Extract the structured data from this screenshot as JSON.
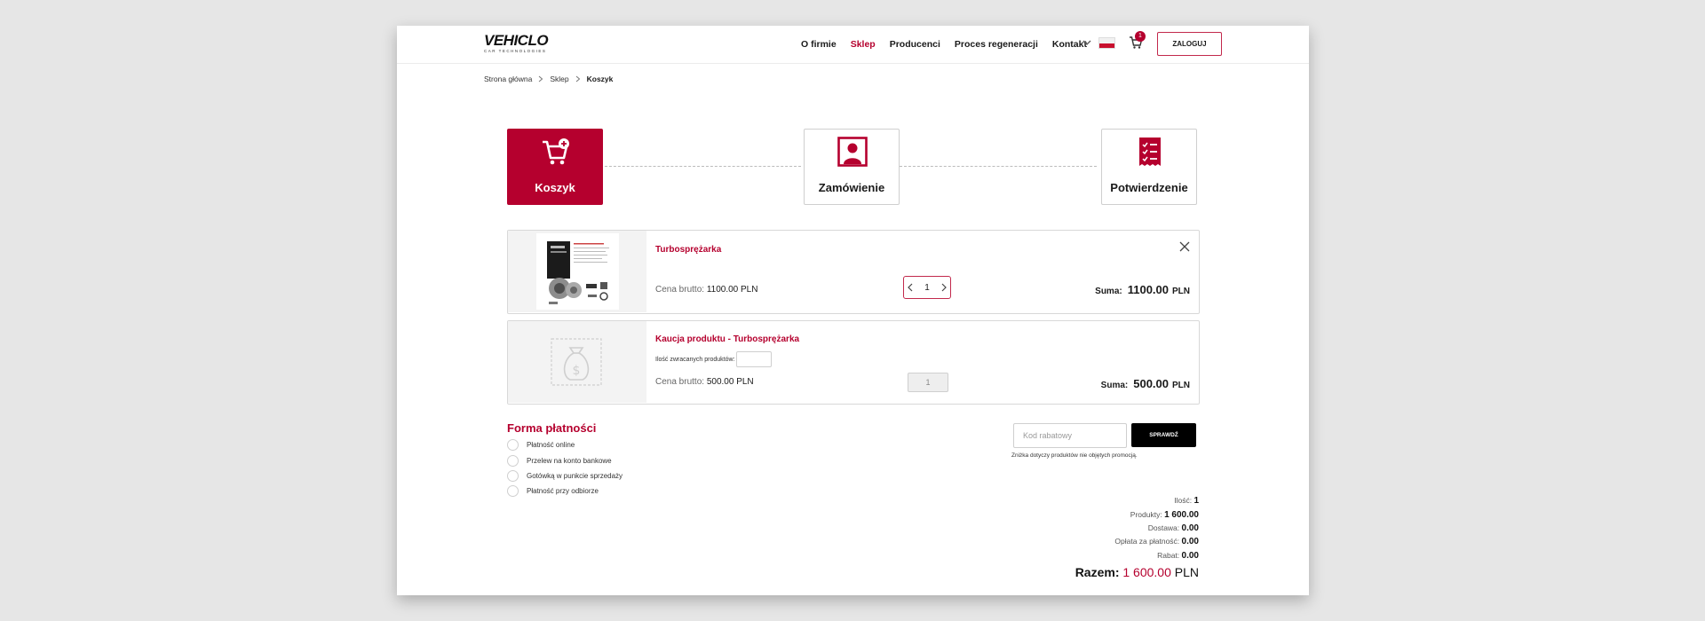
{
  "header": {
    "logo_main": "VEHICLO",
    "logo_sub": "CAR TECHNOLOGIES",
    "nav": [
      {
        "label": "O firmie",
        "active": false
      },
      {
        "label": "Sklep",
        "active": true
      },
      {
        "label": "Producenci",
        "active": false
      },
      {
        "label": "Proces regeneracji",
        "active": false
      },
      {
        "label": "Kontakt",
        "active": false
      }
    ],
    "cart_count": "1",
    "login_label": "ZALOGUJ",
    "icons": {
      "language": "chevron-down-icon",
      "flag": "poland-flag-icon",
      "cart": "cart-icon"
    }
  },
  "breadcrumb": {
    "items": [
      "Strona główna",
      "Sklep",
      "Koszyk"
    ]
  },
  "steps": [
    {
      "label": "Koszyk",
      "icon": "cart-plus-icon",
      "active": true
    },
    {
      "label": "Zamówienie",
      "icon": "user-icon",
      "active": false
    },
    {
      "label": "Potwierdzenie",
      "icon": "checklist-icon",
      "active": false
    }
  ],
  "items": [
    {
      "name": "Turbosprężarka",
      "price_label": "Cena brutto:",
      "price_value": "1100.00 PLN",
      "quantity": "1",
      "sum_label": "Suma:",
      "sum_value": "1100.00",
      "currency": "PLN"
    },
    {
      "name": "Kaucja produktu - Turbosprężarka",
      "return_label": "Ilość zwracanych produktów:",
      "price_label": "Cena brutto:",
      "price_value": "500.00 PLN",
      "quantity": "1",
      "sum_label": "Suma:",
      "sum_value": "500.00",
      "currency": "PLN"
    }
  ],
  "payment": {
    "title": "Forma płatności",
    "options": [
      "Płatność online",
      "Przelew na konto bankowe",
      "Gotówką w punkcie sprzedaży",
      "Płatność przy odbiorze"
    ]
  },
  "discount": {
    "placeholder": "Kod rabatowy",
    "button_label": "SPRAWDŹ",
    "note": "Zniżka dotyczy produktów nie objętych promocją."
  },
  "summary": {
    "rows": [
      {
        "label": "Ilość:",
        "value": "1"
      },
      {
        "label": "Produkty:",
        "value": "1 600.00"
      },
      {
        "label": "Dostawa:",
        "value": "0.00"
      },
      {
        "label": "Opłata za płatność:",
        "value": "0.00"
      },
      {
        "label": "Rabat:",
        "value": "0.00"
      }
    ],
    "total_label": "Razem:",
    "total_value": "1 600.00",
    "total_currency": "PLN"
  },
  "colors": {
    "accent": "#b5002e",
    "button_dark": "#000000",
    "background": "#e6e6e6"
  }
}
